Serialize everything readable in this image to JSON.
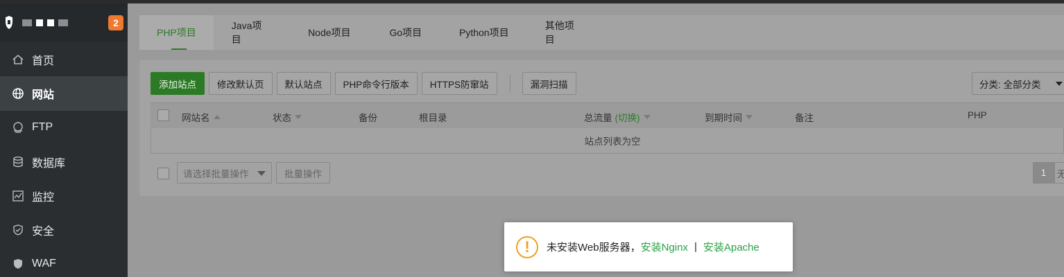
{
  "sidebar": {
    "badge": "2",
    "items": [
      {
        "label": "首页",
        "icon": "home-icon"
      },
      {
        "label": "网站",
        "icon": "globe-icon",
        "active": true
      },
      {
        "label": "FTP",
        "icon": "ftp-icon"
      },
      {
        "label": "数据库",
        "icon": "database-icon"
      },
      {
        "label": "监控",
        "icon": "monitor-icon"
      },
      {
        "label": "安全",
        "icon": "shield-icon"
      },
      {
        "label": "WAF",
        "icon": "waf-shield-icon"
      }
    ]
  },
  "tabs": [
    {
      "label": "PHP项目",
      "active": true
    },
    {
      "label": "Java项目"
    },
    {
      "label": "Node项目"
    },
    {
      "label": "Go项目"
    },
    {
      "label": "Python项目"
    },
    {
      "label": "其他项目"
    }
  ],
  "toolbar": {
    "add_site": "添加站点",
    "edit_default_page": "修改默认页",
    "default_site": "默认站点",
    "php_cli_version": "PHP命令行版本",
    "https_guard": "HTTPS防窜站",
    "vuln_scan": "漏洞扫描",
    "category": "分类: 全部分类"
  },
  "table": {
    "columns": {
      "site_name": "网站名",
      "status": "状态",
      "backup": "备份",
      "root_dir": "根目录",
      "traffic": "总流量",
      "traffic_switch": "(切换)",
      "expiry": "到期时间",
      "note": "备注",
      "php": "PHP"
    },
    "empty_text": "站点列表为空"
  },
  "batch": {
    "select_placeholder": "请选择批量操作",
    "button": "批量操作"
  },
  "pager": {
    "current": "1",
    "next_partial": "无"
  },
  "toast": {
    "message": "未安装Web服务器，",
    "install_nginx": "安装Nginx",
    "divider": "|",
    "install_apache": "安装Apache"
  },
  "colors": {
    "accent_green": "#2e7a27",
    "link_green": "#2ba245",
    "badge_orange": "#ee7930",
    "warning_orange": "#f0a020"
  }
}
